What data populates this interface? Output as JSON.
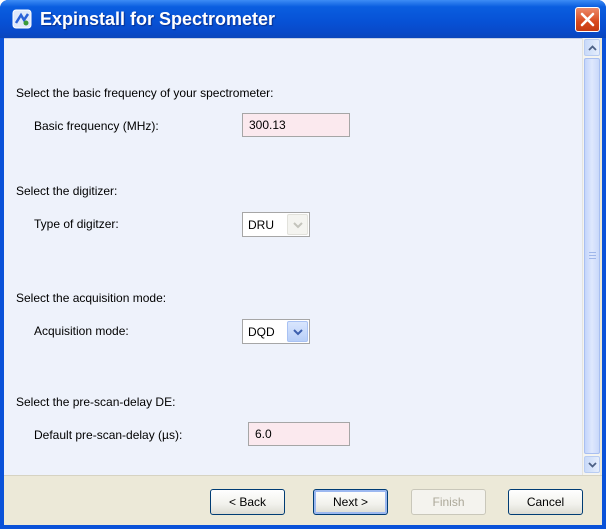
{
  "window": {
    "title": "Expinstall for Spectrometer"
  },
  "sections": {
    "frequency": {
      "heading": "Select the basic frequency of your spectrometer:",
      "field_label": "Basic frequency (MHz):",
      "value": "300.13"
    },
    "digitizer": {
      "heading": "Select the digitizer:",
      "field_label": "Type of digitzer:",
      "selected": "DRU",
      "enabled": false
    },
    "acquisition": {
      "heading": "Select the acquisition mode:",
      "field_label": "Acquisition mode:",
      "selected": "DQD",
      "enabled": true
    },
    "prescan": {
      "heading": "Select the pre-scan-delay DE:",
      "field_label": "Default pre-scan-delay (µs):",
      "value": "6.0"
    }
  },
  "buttons": {
    "back": "< Back",
    "next": "Next >",
    "finish": "Finish",
    "cancel": "Cancel"
  },
  "colors": {
    "titlebar": "#0752d6",
    "field_background": "#fbe9ee",
    "content_background": "#eef2fb",
    "button_border": "#003c74"
  },
  "icons": [
    "app-icon",
    "close-icon",
    "scroll-up-icon",
    "scroll-down-icon",
    "chevron-down-icon"
  ]
}
